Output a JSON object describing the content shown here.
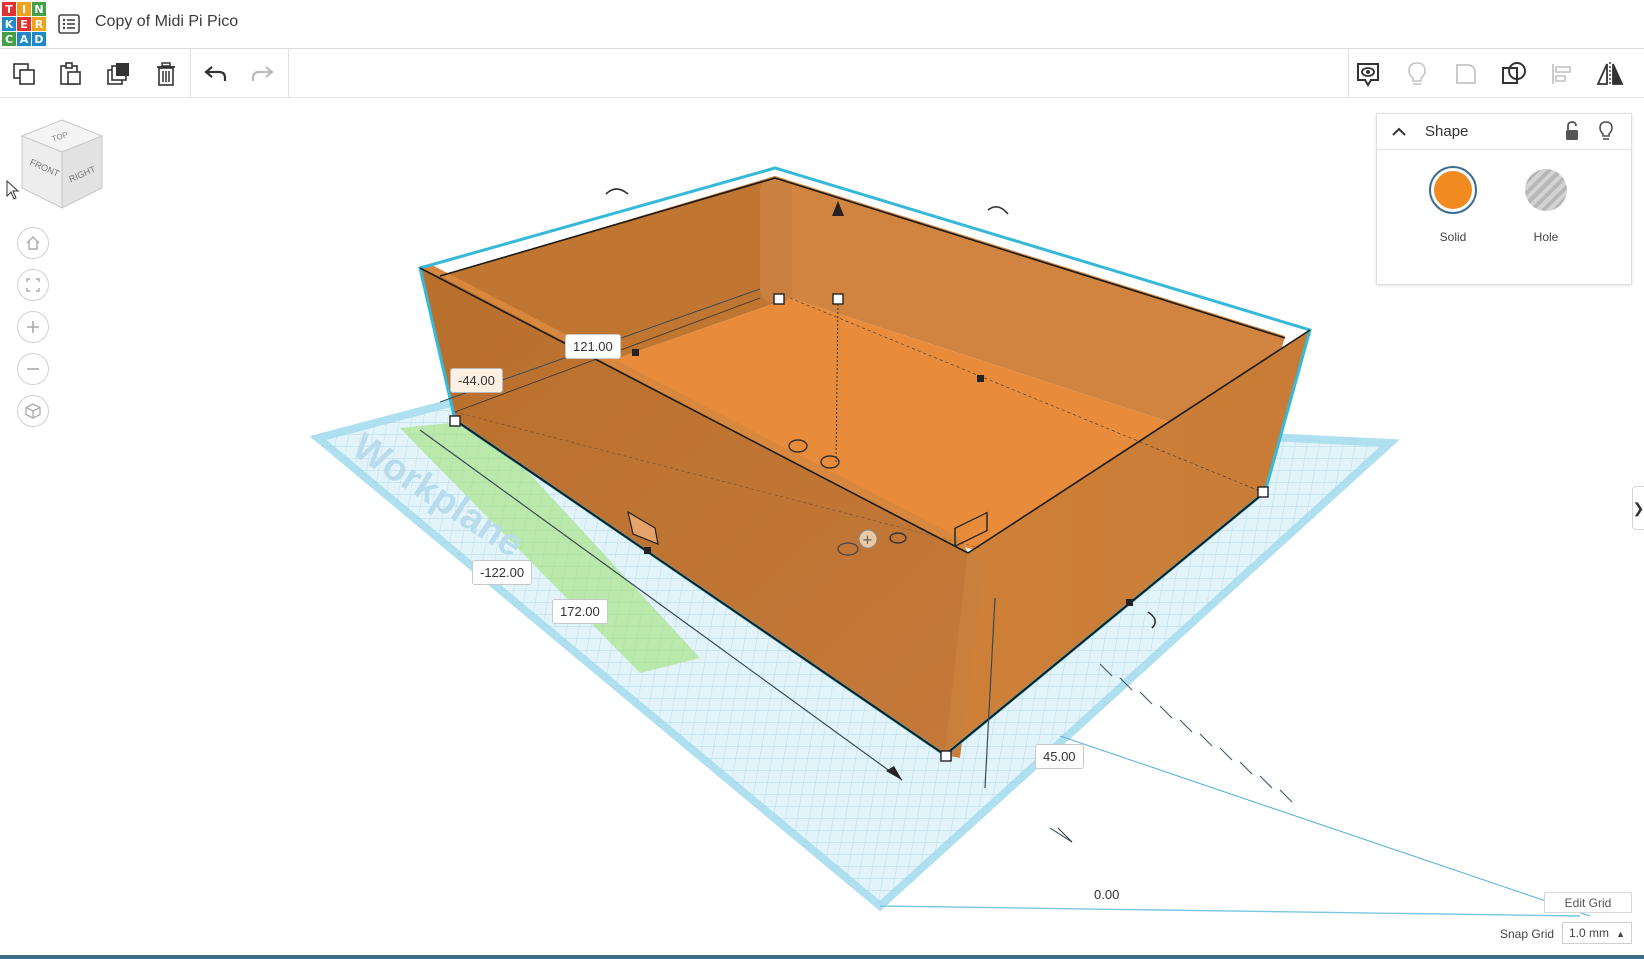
{
  "app": {
    "logo_letters": [
      "T",
      "I",
      "N",
      "K",
      "E",
      "R",
      "C",
      "A",
      "D"
    ],
    "logo_colors": [
      "#e2322e",
      "#f0a21c",
      "#43a047",
      "#1e88c8",
      "#e2322e",
      "#f0a21c",
      "#43a047",
      "#1e88c8",
      "#1e88c8"
    ],
    "document_title": "Copy of Midi Pi Pico"
  },
  "toolbar": {
    "left": [
      {
        "name": "copy-button",
        "icon": "copy-icon"
      },
      {
        "name": "paste-button",
        "icon": "paste-icon"
      },
      {
        "name": "duplicate-button",
        "icon": "duplicate-icon"
      },
      {
        "name": "delete-button",
        "icon": "trash-icon"
      },
      {
        "name": "undo-button",
        "icon": "undo-icon"
      },
      {
        "name": "redo-button",
        "icon": "redo-icon"
      }
    ],
    "right": [
      {
        "name": "notes-button",
        "icon": "eye-bubble-icon"
      },
      {
        "name": "show-all-button",
        "icon": "bulb-icon"
      },
      {
        "name": "group-button",
        "icon": "group-icon"
      },
      {
        "name": "ungroup-button",
        "icon": "ungroup-icon"
      },
      {
        "name": "align-button",
        "icon": "align-icon"
      },
      {
        "name": "mirror-button",
        "icon": "mirror-icon"
      }
    ]
  },
  "viewcube": {
    "top": "TOP",
    "front": "FRONT",
    "right": "RIGHT"
  },
  "workplane_label": "Workplane",
  "dimensions": {
    "width": "121.00",
    "offset_y": "-44.00",
    "offset_x": "-122.00",
    "length": "172.00",
    "height": "45.00",
    "elevation": "0.00"
  },
  "shape_panel": {
    "title": "Shape",
    "solid_label": "Solid",
    "hole_label": "Hole",
    "solid_color": "#f28a22"
  },
  "grid": {
    "edit_label": "Edit Grid",
    "snap_label": "Snap Grid",
    "snap_value": "1.0 mm"
  },
  "side_tab_glyph": "❯"
}
